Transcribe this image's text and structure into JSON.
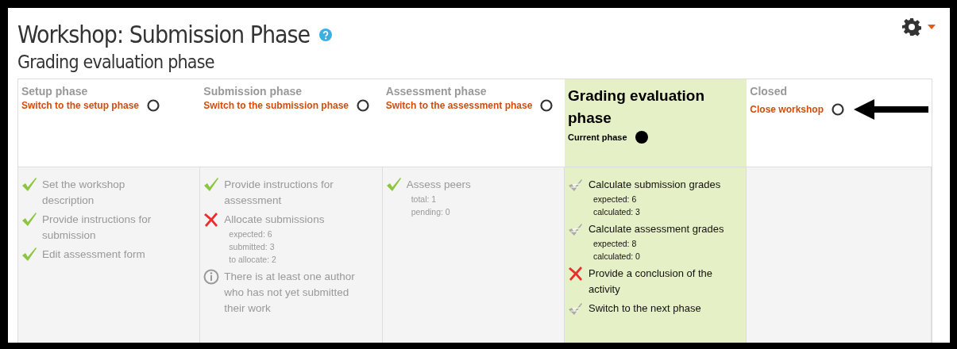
{
  "page": {
    "title": "Workshop: Submission Phase",
    "subtitle": "Grading evaluation phase"
  },
  "phases": [
    {
      "name": "Setup phase",
      "action": "Switch to the setup phase",
      "selected": false,
      "tasks": [
        {
          "kind": "done",
          "text": "Set the workshop description"
        },
        {
          "kind": "done",
          "text": "Provide instructions for submission"
        },
        {
          "kind": "done",
          "text": "Edit assessment form"
        }
      ]
    },
    {
      "name": "Submission phase",
      "action": "Switch to the submission phase",
      "selected": false,
      "tasks": [
        {
          "kind": "done",
          "text": "Provide instructions for assessment"
        },
        {
          "kind": "fail",
          "text": "Allocate submissions",
          "details": [
            "expected: 6",
            "submitted: 3",
            "to allocate: 2"
          ]
        },
        {
          "kind": "info",
          "text": "There is at least one author who has not yet submitted their work"
        }
      ]
    },
    {
      "name": "Assessment phase",
      "action": "Switch to the assessment phase",
      "selected": false,
      "tasks": [
        {
          "kind": "done",
          "text": "Assess peers",
          "details": [
            "total: 1",
            "pending: 0"
          ]
        }
      ]
    },
    {
      "name": "Grading evaluation phase",
      "action": "Current phase",
      "selected": true,
      "tasks": [
        {
          "kind": "todo",
          "text": "Calculate submission grades",
          "details": [
            "expected: 6",
            "calculated: 3"
          ]
        },
        {
          "kind": "todo",
          "text": "Calculate assessment grades",
          "details": [
            "expected: 8",
            "calculated: 0"
          ]
        },
        {
          "kind": "fail",
          "text": "Provide a conclusion of the activity"
        },
        {
          "kind": "todo",
          "text": "Switch to the next phase"
        }
      ]
    },
    {
      "name": "Closed",
      "action": "Close workshop",
      "selected": false,
      "pointer": true
    }
  ]
}
